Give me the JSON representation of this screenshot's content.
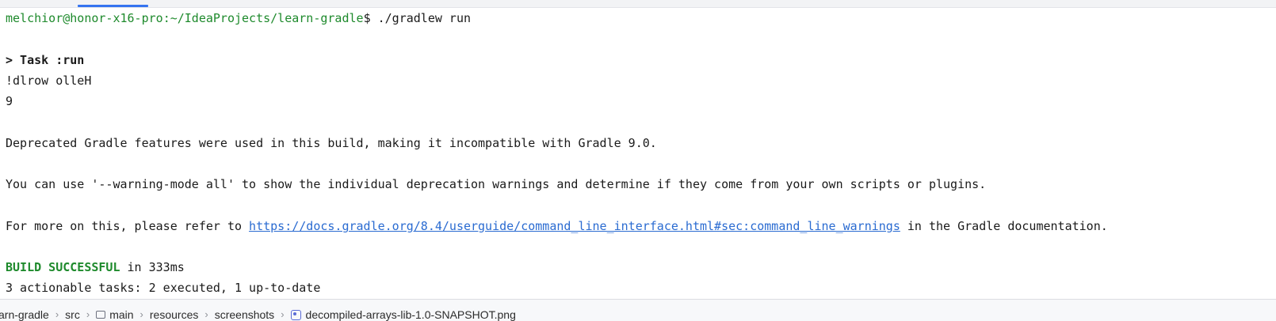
{
  "terminal": {
    "prompt_user_host": "melchior@honor-x16-pro",
    "prompt_path": ":~/IdeaProjects/learn-gradle",
    "prompt_symbol": "$ ",
    "command": "./gradlew run",
    "task_line": "> Task :run",
    "output_line_1": "!dlrow olleH",
    "output_line_2": "9",
    "deprecation_line": "Deprecated Gradle features were used in this build, making it incompatible with Gradle 9.0.",
    "warning_mode_line": "You can use '--warning-mode all' to show the individual deprecation warnings and determine if they come from your own scripts or plugins.",
    "more_info_prefix": "For more on this, please refer to ",
    "more_info_link": "https://docs.gradle.org/8.4/userguide/command_line_interface.html#sec:command_line_warnings",
    "more_info_suffix": " in the Gradle documentation.",
    "build_status": "BUILD SUCCESSFUL",
    "build_time": " in 333ms",
    "tasks_summary": "3 actionable tasks: 2 executed, 1 up-to-date"
  },
  "breadcrumbs": {
    "items": [
      {
        "label": "arn-gradle",
        "icon": null
      },
      {
        "label": "src",
        "icon": null
      },
      {
        "label": "main",
        "icon": "folder-icon"
      },
      {
        "label": "resources",
        "icon": null
      },
      {
        "label": "screenshots",
        "icon": null
      },
      {
        "label": "decompiled-arrays-lib-1.0-SNAPSHOT.png",
        "icon": "image-icon"
      }
    ],
    "separator": "›"
  },
  "colors": {
    "prompt_green": "#1e8a2c",
    "link_blue": "#2a6bd1",
    "tab_accent": "#3574f0"
  }
}
